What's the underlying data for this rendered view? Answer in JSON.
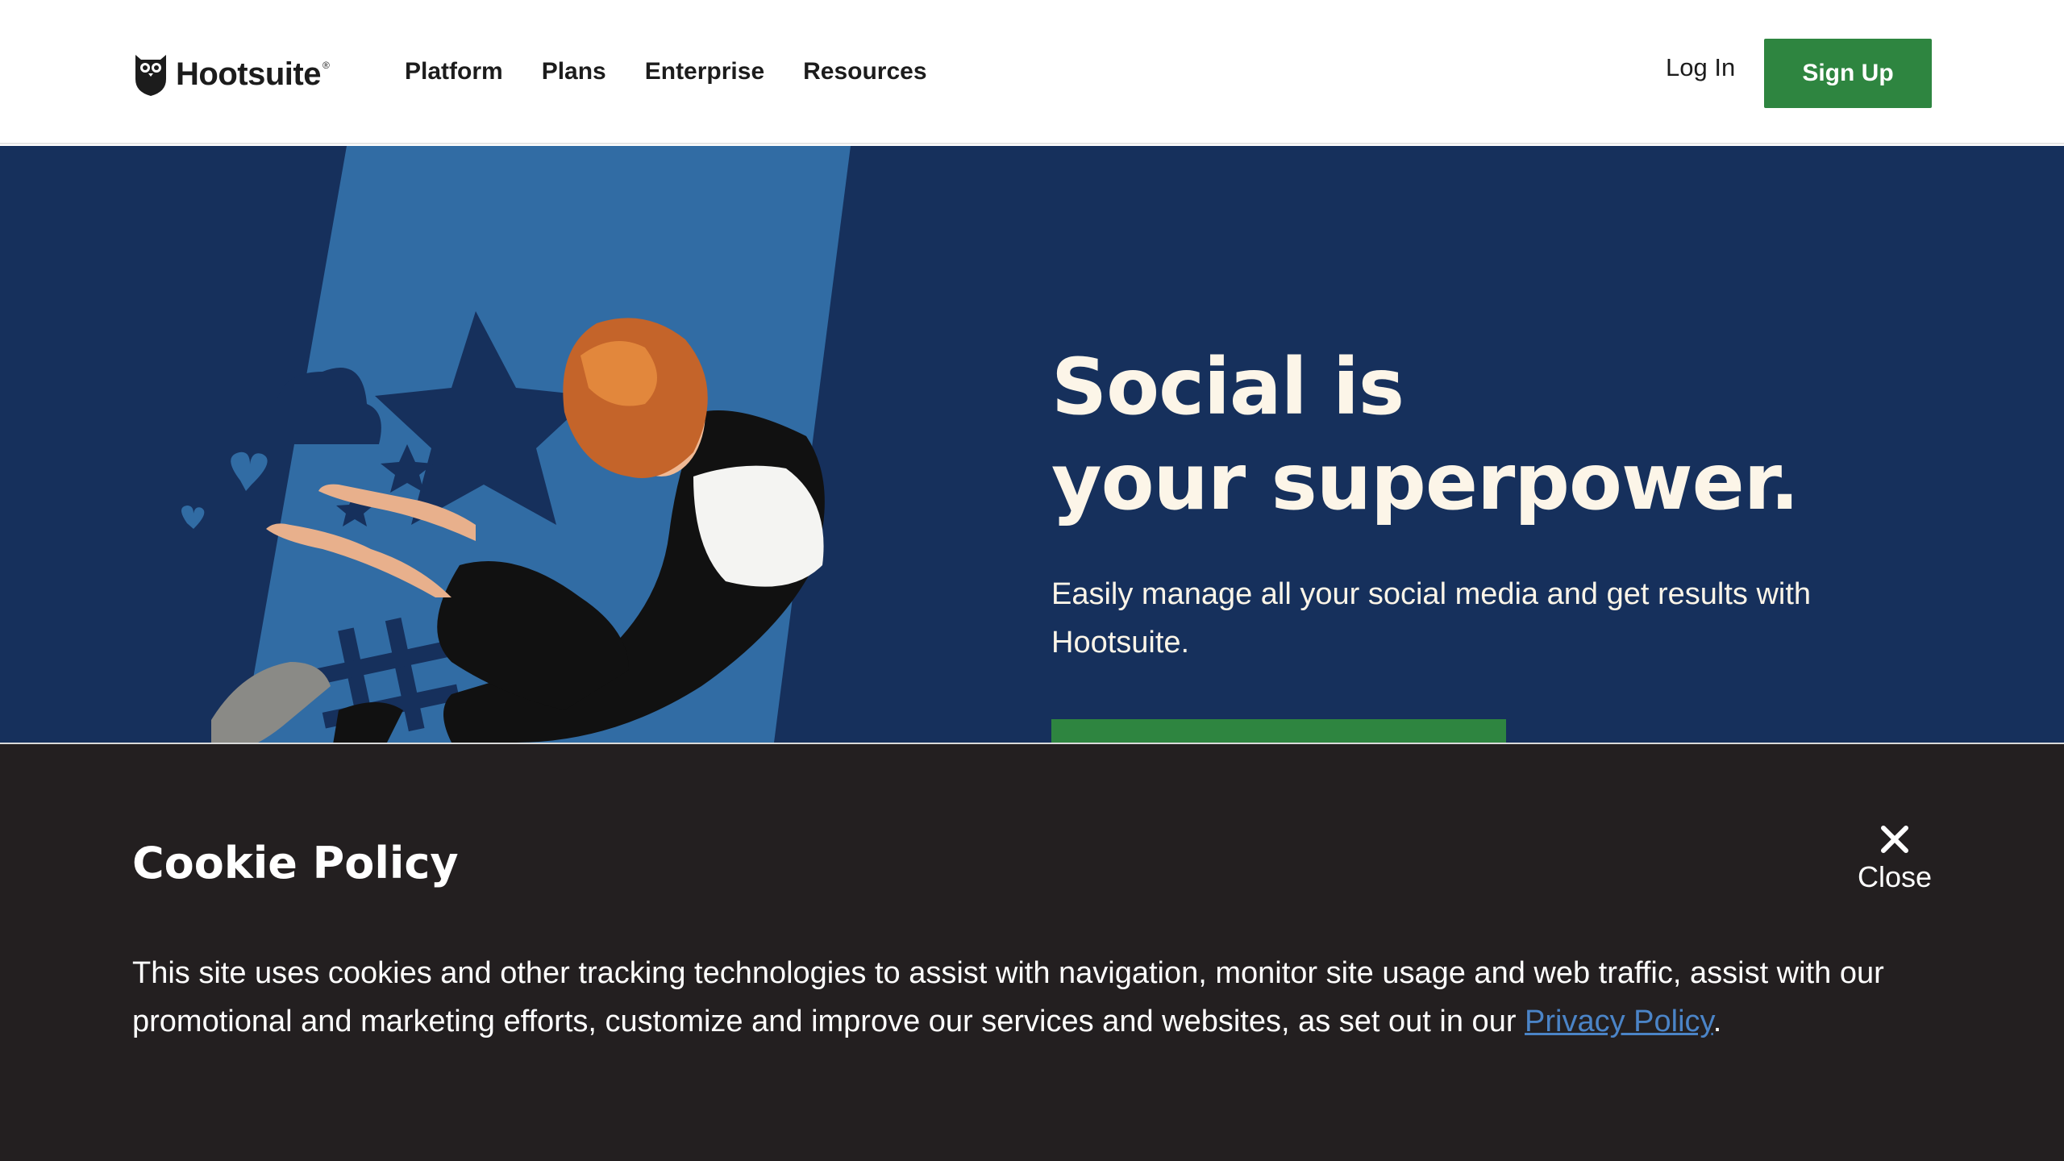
{
  "brand": {
    "name": "Hootsuite",
    "reg": "®",
    "accent": "#2e8540",
    "hero_bg": "#16305c",
    "hero_text": "#fcf5e8"
  },
  "header": {
    "nav": [
      "Platform",
      "Plans",
      "Enterprise",
      "Resources"
    ],
    "login_label": "Log In",
    "signup_label": "Sign Up"
  },
  "hero": {
    "title_line1": "Social is",
    "title_line2": "your superpower.",
    "subtitle": "Easily manage all your social media and get results with Hootsuite.",
    "image": "woman jumping with stars and hearts illustration"
  },
  "cookie": {
    "title": "Cookie Policy",
    "close_label": "Close",
    "close_icon": "close-icon",
    "text_before": "This site uses cookies and other tracking technologies to assist with navigation, monitor site usage and web traffic, assist with our promotional and marketing efforts, customize and improve our services and websites, as set out in our ",
    "link_label": "Privacy Policy",
    "text_after": ".",
    "bg": "#231f20",
    "link_color": "#4b84c7"
  }
}
